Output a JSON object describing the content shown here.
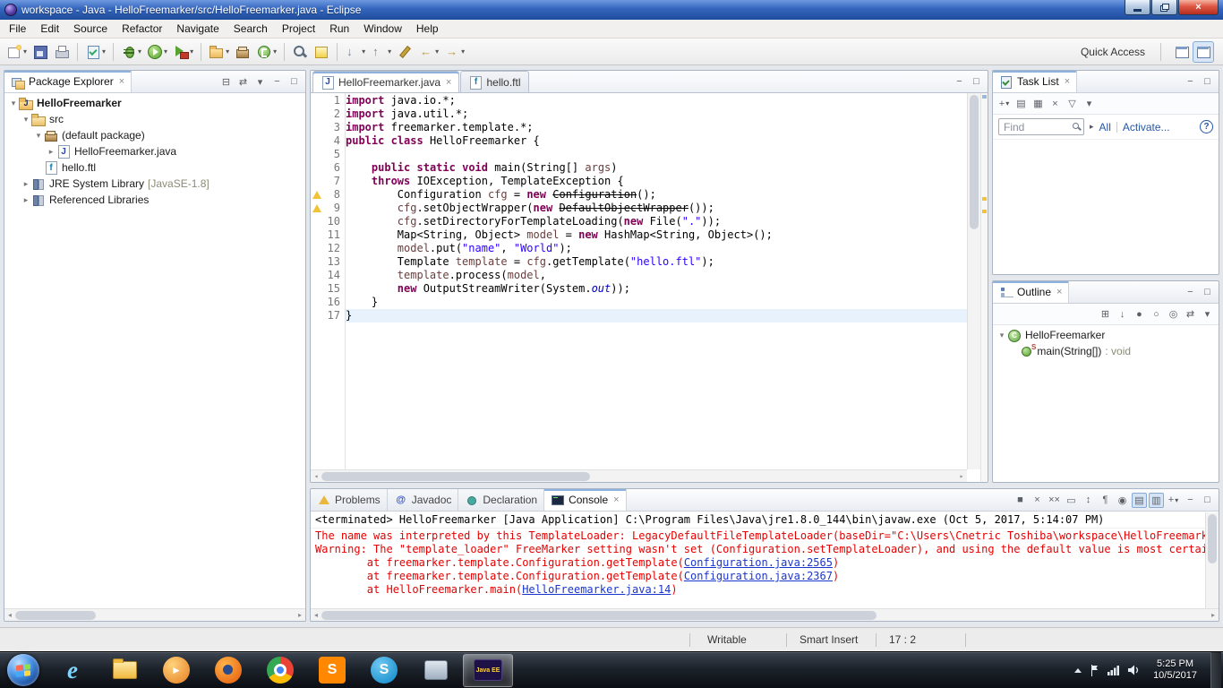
{
  "glyphs": {
    "close": "×",
    "dropdown": "▾",
    "collapsed": "▸",
    "expanded": "▾",
    "help": "?",
    "minimize": "−",
    "maximize": "□",
    "left_arrow": "◂",
    "right_arrow": "▸"
  },
  "window": {
    "title": "workspace - Java - HelloFreemarker/src/HelloFreemarker.java - Eclipse"
  },
  "menubar": {
    "items": [
      "File",
      "Edit",
      "Source",
      "Refactor",
      "Navigate",
      "Search",
      "Project",
      "Run",
      "Window",
      "Help"
    ]
  },
  "toolbar": {
    "quick_access_label": "Quick Access",
    "groups": [
      {
        "items": [
          {
            "name": "new-wizard-button",
            "type": "new",
            "dd": true
          },
          {
            "name": "save-button",
            "type": "save"
          },
          {
            "name": "print-button",
            "type": "print"
          }
        ]
      },
      {
        "items": [
          {
            "name": "open-task-button",
            "type": "task",
            "dd": true
          }
        ]
      },
      {
        "items": [
          {
            "name": "debug-button",
            "type": "debug",
            "dd": true
          },
          {
            "name": "run-button",
            "type": "run",
            "dd": true
          },
          {
            "name": "run-external-tools-button",
            "type": "ext",
            "dd": true
          }
        ]
      },
      {
        "items": [
          {
            "name": "new-java-project-button",
            "type": "jproj",
            "dd": true
          },
          {
            "name": "new-package-button",
            "type": "pkg"
          },
          {
            "name": "new-class-button",
            "type": "class",
            "dd": true
          }
        ]
      },
      {
        "items": [
          {
            "name": "java-search-button",
            "type": "search"
          },
          {
            "name": "mark-occurrences-button",
            "type": "mark"
          }
        ]
      },
      {
        "items": [
          {
            "name": "next-annotation-button",
            "type": "nextann",
            "dd": true
          },
          {
            "name": "previous-annotation-button",
            "type": "prevann",
            "dd": true
          },
          {
            "name": "last-edit-location-button",
            "type": "lastedit"
          },
          {
            "name": "back-button",
            "type": "back",
            "dd": true
          },
          {
            "name": "forward-button",
            "type": "forward",
            "dd": true
          }
        ]
      }
    ],
    "perspective_buttons": [
      {
        "name": "open-perspective-button"
      },
      {
        "name": "java-ee-perspective-button",
        "active": true
      }
    ]
  },
  "package_explorer": {
    "title": "Package Explorer",
    "tools": [
      {
        "name": "collapse-all-button",
        "glyph": "⊟"
      },
      {
        "name": "link-with-editor-button",
        "glyph": "⇄"
      },
      {
        "name": "view-menu-button",
        "glyph": "▾"
      },
      {
        "name": "minimize-button",
        "glyph": "−"
      },
      {
        "name": "maximize-button",
        "glyph": "□"
      }
    ],
    "items": [
      {
        "label": "HelloFreemarker",
        "depth": 0,
        "expander": "expanded",
        "icon": "java-project-icon",
        "bold": true
      },
      {
        "label": "src",
        "depth": 1,
        "expander": "expanded",
        "icon": "source-folder-icon"
      },
      {
        "label": "(default package)",
        "depth": 2,
        "expander": "expanded",
        "icon": "package-icon"
      },
      {
        "label": "HelloFreemarker.java",
        "depth": 3,
        "expander": "collapsed",
        "icon": "java-file-icon"
      },
      {
        "label": "hello.ftl",
        "depth": 2,
        "expander": "none",
        "icon": "ftl-file-icon"
      },
      {
        "label": "JRE System Library",
        "suffix": "[JavaSE-1.8]",
        "depth": 1,
        "expander": "collapsed",
        "icon": "library-icon"
      },
      {
        "label": "Referenced Libraries",
        "depth": 1,
        "expander": "collapsed",
        "icon": "library-icon"
      }
    ]
  },
  "editor": {
    "tabs": [
      {
        "label": "HelloFreemarker.java",
        "icon": "java-file-icon",
        "active": true
      },
      {
        "label": "hello.ftl",
        "icon": "ftl-file-icon",
        "active": false
      }
    ],
    "stack_tools": [
      {
        "name": "minimize-button",
        "glyph": "−"
      },
      {
        "name": "maximize-button",
        "glyph": "□"
      }
    ],
    "current_line": 17,
    "warning_lines": [
      8,
      9
    ],
    "code": [
      {
        "n": 1,
        "tokens": [
          [
            "k",
            "import"
          ],
          [
            "p",
            " java.io.*;"
          ]
        ]
      },
      {
        "n": 2,
        "tokens": [
          [
            "k",
            "import"
          ],
          [
            "p",
            " java.util.*;"
          ]
        ]
      },
      {
        "n": 3,
        "tokens": [
          [
            "k",
            "import"
          ],
          [
            "p",
            " freemarker.template.*;"
          ]
        ]
      },
      {
        "n": 4,
        "tokens": [
          [
            "k",
            "public"
          ],
          [
            "p",
            " "
          ],
          [
            "k",
            "class"
          ],
          [
            "p",
            " HelloFreemarker {"
          ]
        ]
      },
      {
        "n": 5,
        "tokens": []
      },
      {
        "n": 6,
        "tokens": [
          [
            "p",
            "    "
          ],
          [
            "k",
            "public"
          ],
          [
            "p",
            " "
          ],
          [
            "k",
            "static"
          ],
          [
            "p",
            " "
          ],
          [
            "k",
            "void"
          ],
          [
            "p",
            " main(String[] "
          ],
          [
            "v",
            "args"
          ],
          [
            "p",
            ")"
          ]
        ]
      },
      {
        "n": 7,
        "tokens": [
          [
            "p",
            "    "
          ],
          [
            "k",
            "throws"
          ],
          [
            "p",
            " IOException, TemplateException {"
          ]
        ]
      },
      {
        "n": 8,
        "tokens": [
          [
            "p",
            "        Configuration "
          ],
          [
            "v",
            "cfg"
          ],
          [
            "p",
            " = "
          ],
          [
            "k",
            "new"
          ],
          [
            "p",
            " "
          ],
          [
            "d",
            "Configuration"
          ],
          [
            "p",
            "();"
          ]
        ]
      },
      {
        "n": 9,
        "tokens": [
          [
            "p",
            "        "
          ],
          [
            "v",
            "cfg"
          ],
          [
            "p",
            ".setObjectWrapper("
          ],
          [
            "k",
            "new"
          ],
          [
            "p",
            " "
          ],
          [
            "d",
            "DefaultObjectWrapper"
          ],
          [
            "p",
            "());"
          ]
        ]
      },
      {
        "n": 10,
        "tokens": [
          [
            "p",
            "        "
          ],
          [
            "v",
            "cfg"
          ],
          [
            "p",
            ".setDirectoryForTemplateLoading("
          ],
          [
            "k",
            "new"
          ],
          [
            "p",
            " File("
          ],
          [
            "s",
            "\".\""
          ],
          [
            "p",
            "));"
          ]
        ]
      },
      {
        "n": 11,
        "tokens": [
          [
            "p",
            "        Map<String, Object> "
          ],
          [
            "v",
            "model"
          ],
          [
            "p",
            " = "
          ],
          [
            "k",
            "new"
          ],
          [
            "p",
            " HashMap<String, Object>();"
          ]
        ]
      },
      {
        "n": 12,
        "tokens": [
          [
            "p",
            "        "
          ],
          [
            "v",
            "model"
          ],
          [
            "p",
            ".put("
          ],
          [
            "s",
            "\"name\""
          ],
          [
            "p",
            ", "
          ],
          [
            "s",
            "\"World\""
          ],
          [
            "p",
            ");"
          ]
        ]
      },
      {
        "n": 13,
        "tokens": [
          [
            "p",
            "        Template "
          ],
          [
            "v",
            "template"
          ],
          [
            "p",
            " = "
          ],
          [
            "v",
            "cfg"
          ],
          [
            "p",
            ".getTemplate("
          ],
          [
            "s",
            "\"hello.ftl\""
          ],
          [
            "p",
            ");"
          ]
        ]
      },
      {
        "n": 14,
        "tokens": [
          [
            "p",
            "        "
          ],
          [
            "v",
            "template"
          ],
          [
            "p",
            ".process("
          ],
          [
            "v",
            "model"
          ],
          [
            "p",
            ","
          ]
        ]
      },
      {
        "n": 15,
        "tokens": [
          [
            "p",
            "        "
          ],
          [
            "k",
            "new"
          ],
          [
            "p",
            " OutputStreamWriter(System."
          ],
          [
            "f",
            "out"
          ],
          [
            "p",
            "));"
          ]
        ]
      },
      {
        "n": 16,
        "tokens": [
          [
            "p",
            "    }"
          ]
        ]
      },
      {
        "n": 17,
        "tokens": [
          [
            "p",
            "}"
          ]
        ]
      }
    ]
  },
  "task_list": {
    "title": "Task List",
    "find_placeholder": "Find",
    "links": [
      "All",
      "Activate..."
    ],
    "header_tools": [
      {
        "name": "minimize-button",
        "glyph": "−"
      },
      {
        "name": "maximize-button",
        "glyph": "□"
      }
    ],
    "tools": [
      {
        "name": "new-task-button",
        "glyph": "+",
        "dd": true
      },
      {
        "name": "categorized-button",
        "glyph": "▤"
      },
      {
        "name": "scheduled-button",
        "glyph": "▦"
      },
      {
        "name": "focus-on-workweek-button",
        "glyph": "×"
      },
      {
        "name": "filter-button",
        "glyph": "▽"
      },
      {
        "name": "view-menu-button",
        "glyph": "▾"
      }
    ]
  },
  "outline": {
    "title": "Outline",
    "header_tools": [
      {
        "name": "minimize-button",
        "glyph": "−"
      },
      {
        "name": "maximize-button",
        "glyph": "□"
      }
    ],
    "tools": [
      {
        "name": "expand-all-button",
        "glyph": "⊞"
      },
      {
        "name": "sort-button",
        "glyph": "↓"
      },
      {
        "name": "hide-fields-button",
        "glyph": "●"
      },
      {
        "name": "hide-static-members-button",
        "glyph": "○"
      },
      {
        "name": "hide-non-public-members-button",
        "glyph": "◎"
      },
      {
        "name": "link-with-editor-button",
        "glyph": "⇄"
      },
      {
        "name": "view-menu-button",
        "glyph": "▾"
      }
    ],
    "items": [
      {
        "label": "HelloFreemarker",
        "depth": 0,
        "expander": "expanded",
        "icon": "class-icon"
      },
      {
        "label": "main(String[])",
        "suffix": ": void",
        "depth": 1,
        "expander": "none",
        "icon": "method-icon",
        "decor": "S"
      }
    ]
  },
  "console": {
    "tabs": [
      {
        "label": "Problems",
        "icon": "problems-icon"
      },
      {
        "label": "Javadoc",
        "icon": "javadoc-icon"
      },
      {
        "label": "Declaration",
        "icon": "declaration-icon"
      },
      {
        "label": "Console",
        "icon": "console-icon",
        "active": true
      }
    ],
    "tools": [
      {
        "name": "terminate-button",
        "glyph": "■"
      },
      {
        "name": "remove-launch-button",
        "glyph": "×"
      },
      {
        "name": "remove-all-terminated-button",
        "glyph": "××"
      },
      {
        "name": "clear-console-button",
        "glyph": "▭"
      },
      {
        "name": "scroll-lock-button",
        "glyph": "↕"
      },
      {
        "name": "word-wrap-button",
        "glyph": "¶"
      },
      {
        "name": "pin-console-button",
        "glyph": "◉"
      },
      {
        "name": "show-stdout-button",
        "glyph": "▤",
        "pressed": true
      },
      {
        "name": "show-stderr-button",
        "glyph": "▥",
        "pressed": true
      },
      {
        "name": "open-console-button",
        "glyph": "+",
        "dd": true
      },
      {
        "name": "minimize-button",
        "glyph": "−"
      },
      {
        "name": "maximize-button",
        "glyph": "□"
      }
    ],
    "header": "<terminated> HelloFreemarker [Java Application] C:\\Program Files\\Java\\jre1.8.0_144\\bin\\javaw.exe (Oct 5, 2017, 5:14:07 PM)",
    "lines": [
      {
        "segments": [
          [
            "err",
            "The name was interpreted by this TemplateLoader: LegacyDefaultFileTemplateLoader(baseDir=\"C:\\Users\\Cnetric Toshiba\\workspace\\HelloFreemarker\","
          ]
        ]
      },
      {
        "segments": [
          [
            "err",
            "Warning: The \"template_loader\" FreeMarker setting wasn't set (Configuration.setTemplateLoader), and using the default value is most certainly"
          ]
        ]
      },
      {
        "segments": [
          [
            "err",
            "        at freemarker.template.Configuration.getTemplate("
          ],
          [
            "link",
            "Configuration.java:2565"
          ],
          [
            "err",
            ")"
          ]
        ]
      },
      {
        "segments": [
          [
            "err",
            "        at freemarker.template.Configuration.getTemplate("
          ],
          [
            "link",
            "Configuration.java:2367"
          ],
          [
            "err",
            ")"
          ]
        ]
      },
      {
        "segments": [
          [
            "err",
            "        at HelloFreemarker.main("
          ],
          [
            "link",
            "HelloFreemarker.java:14"
          ],
          [
            "err",
            ")"
          ]
        ]
      }
    ]
  },
  "status_bar": {
    "writable": "Writable",
    "insert_mode": "Smart Insert",
    "caret_position": "17 : 2"
  },
  "taskbar": {
    "apps": [
      {
        "name": "internet-explorer",
        "glyph": "e"
      },
      {
        "name": "windows-explorer"
      },
      {
        "name": "media-player",
        "glyph": "►"
      },
      {
        "name": "firefox"
      },
      {
        "name": "chrome"
      },
      {
        "name": "sublime-text",
        "glyph": "S"
      },
      {
        "name": "skype",
        "glyph": "S"
      },
      {
        "name": "snipping-tool"
      },
      {
        "name": "eclipse-java-ee",
        "label": "Java EE",
        "active": true
      }
    ],
    "clock": {
      "time": "5:25 PM",
      "date": "10/5/2017"
    }
  },
  "icons": {
    "java-project-icon": {
      "letter": "J"
    },
    "java-file-icon": {
      "letter": "J"
    },
    "ftl-file-icon": {
      "letter": "f"
    },
    "class-icon": {
      "letter": "C"
    },
    "javadoc-icon": {
      "letter": "@"
    }
  }
}
